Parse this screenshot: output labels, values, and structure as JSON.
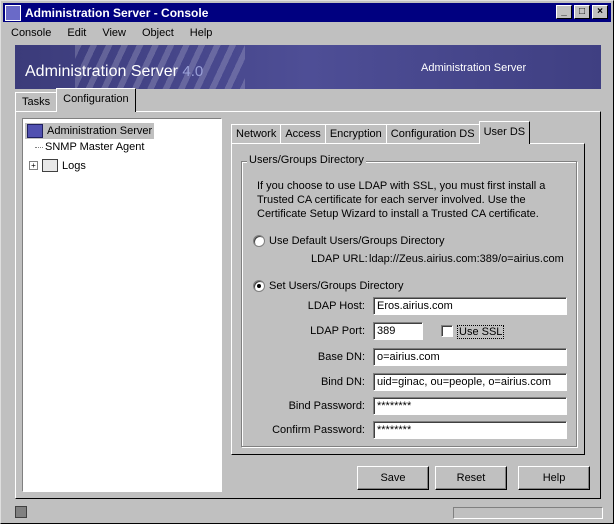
{
  "window": {
    "title": "Administration Server - Console",
    "buttons": {
      "minimize": "_",
      "maximize": "□",
      "close": "×"
    }
  },
  "menu": [
    "Console",
    "Edit",
    "View",
    "Object",
    "Help"
  ],
  "banner": {
    "product": "Administration Server",
    "version": "4.0",
    "right_label": "Administration Server"
  },
  "top_tabs": [
    {
      "label": "Tasks"
    },
    {
      "label": "Configuration"
    }
  ],
  "tree": {
    "items": [
      {
        "label": "Administration Server"
      },
      {
        "label": "SNMP Master Agent"
      },
      {
        "label": "Logs"
      }
    ]
  },
  "sub_tabs": [
    {
      "label": "Network"
    },
    {
      "label": "Access"
    },
    {
      "label": "Encryption"
    },
    {
      "label": "Configuration DS"
    },
    {
      "label": "User DS"
    }
  ],
  "userds": {
    "group_title": "Users/Groups Directory",
    "description": "If you choose to use LDAP with SSL, you must first install a Trusted CA certificate for each server involved. Use the Certificate Setup Wizard to install a Trusted CA certificate.",
    "default_option": "Use Default Users/Groups Directory",
    "ldap_url_label": "LDAP URL:",
    "ldap_url_value": "ldap://Zeus.airius.com:389/o=airius.com",
    "set_option": "Set Users/Groups Directory",
    "ldap_host_label": "LDAP Host:",
    "ldap_host_value": "Eros.airius.com",
    "ldap_port_label": "LDAP Port:",
    "ldap_port_value": "389",
    "use_ssl_label": "Use SSL",
    "use_ssl_checked": false,
    "base_dn_label": "Base DN:",
    "base_dn_value": "o=airius.com",
    "bind_dn_label": "Bind DN:",
    "bind_dn_value": "uid=ginac, ou=people, o=airius.com",
    "bind_password_label": "Bind Password:",
    "bind_password_value": "********",
    "confirm_password_label": "Confirm Password:",
    "confirm_password_value": "********",
    "selected_option": "set"
  },
  "buttons": {
    "save": "Save",
    "reset": "Reset",
    "help": "Help"
  }
}
